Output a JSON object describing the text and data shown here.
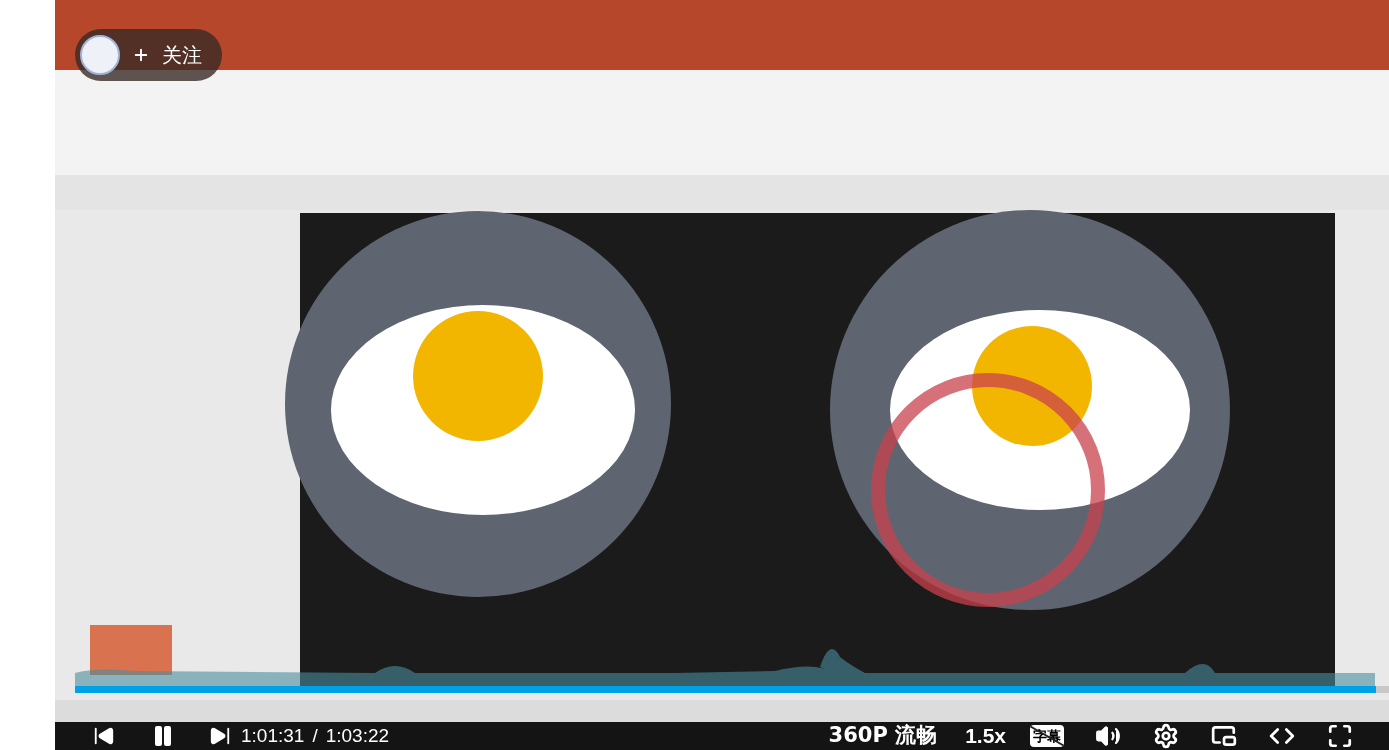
{
  "follow_button": {
    "label": "关注"
  },
  "player": {
    "progress": {
      "level": 0.99
    },
    "playing": true,
    "current_time": "1:01:31",
    "separator": "/",
    "duration": "1:03:22",
    "quality": "360P 流畅",
    "speed": "1.5x",
    "subtitles": {
      "label": "字幕",
      "on": false
    }
  }
}
